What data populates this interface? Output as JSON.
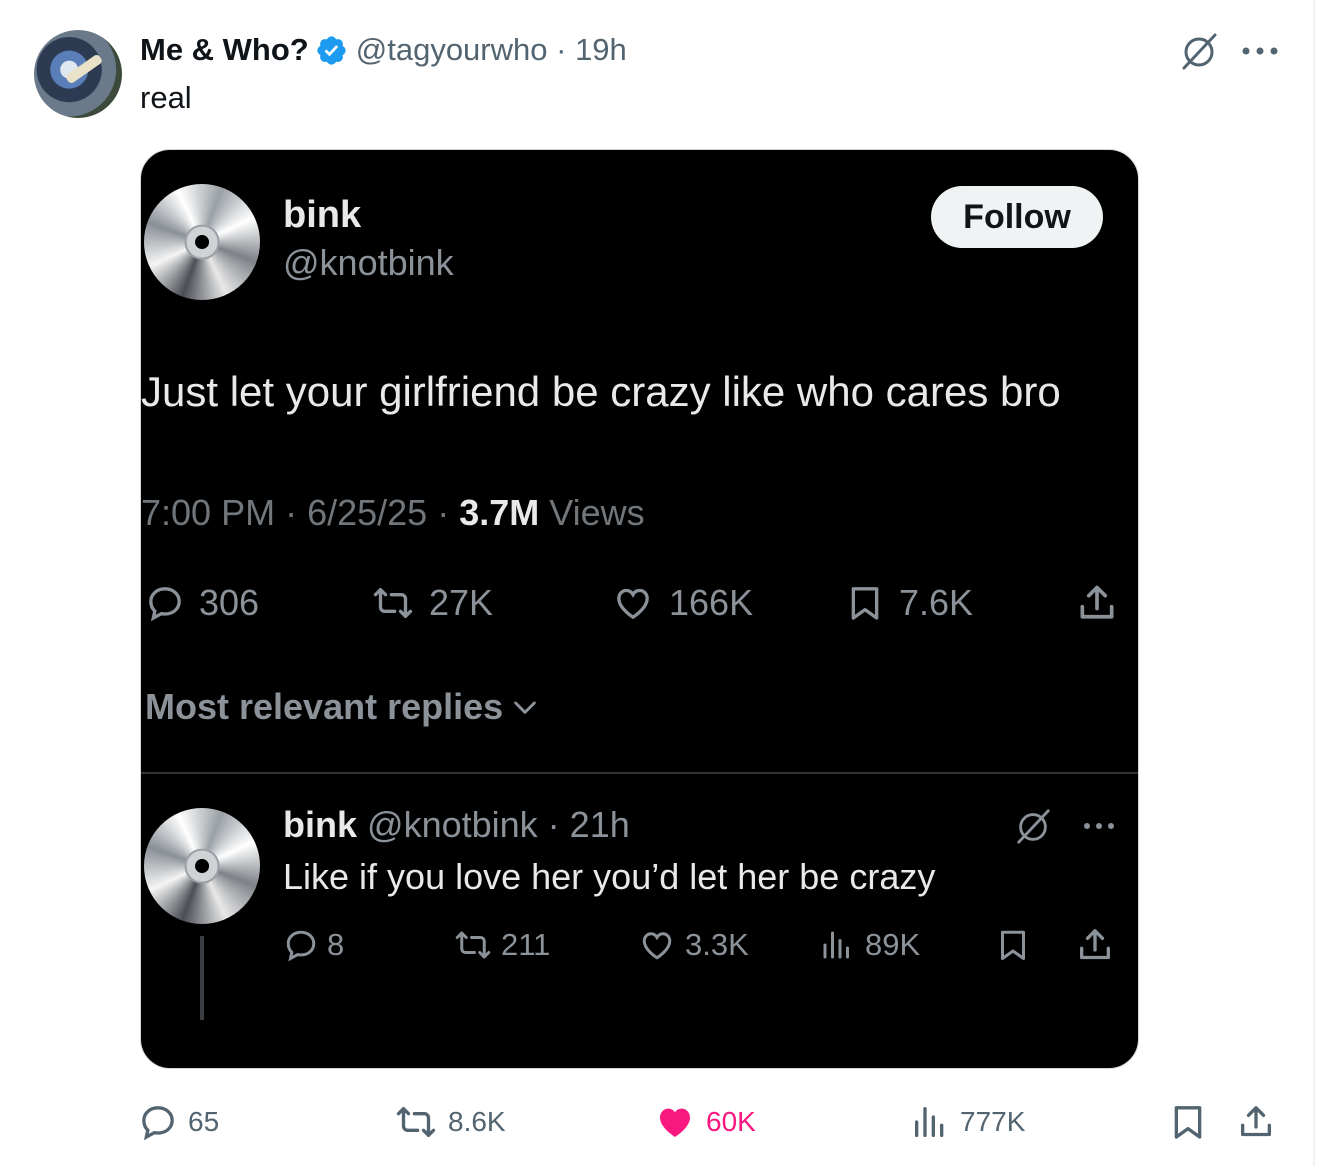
{
  "post": {
    "author_name": "Me & Who?",
    "handle": "@tagyourwho",
    "time": "19h",
    "text": "real",
    "icons": {
      "verified": "verified-badge-icon",
      "grok": "grok-icon",
      "more": "more-icon"
    }
  },
  "quoted": {
    "author_name": "bink",
    "handle": "@knotbink",
    "follow_label": "Follow",
    "text": "Just let your girlfriend be crazy like who cares bro",
    "time": "7:00 PM",
    "date": "6/25/25",
    "views_count": "3.7M",
    "views_label": "Views",
    "stats": {
      "replies": "306",
      "reposts": "27K",
      "likes": "166K",
      "bookmarks": "7.6K"
    },
    "replies_sort_label": "Most relevant replies",
    "reply": {
      "author_name": "bink",
      "handle": "@knotbink",
      "time": "21h",
      "text": "Like if you love her you’d let her be crazy",
      "stats": {
        "replies": "8",
        "reposts": "211",
        "likes": "3.3K",
        "views": "89K"
      }
    }
  },
  "engagement": {
    "replies": "65",
    "reposts": "8.6K",
    "likes": "60K",
    "views": "777K",
    "liked": true,
    "like_color": "#f91880"
  },
  "colors": {
    "verified_blue": "#1d9bf0",
    "card_bg": "#000000",
    "muted": "#536471"
  }
}
